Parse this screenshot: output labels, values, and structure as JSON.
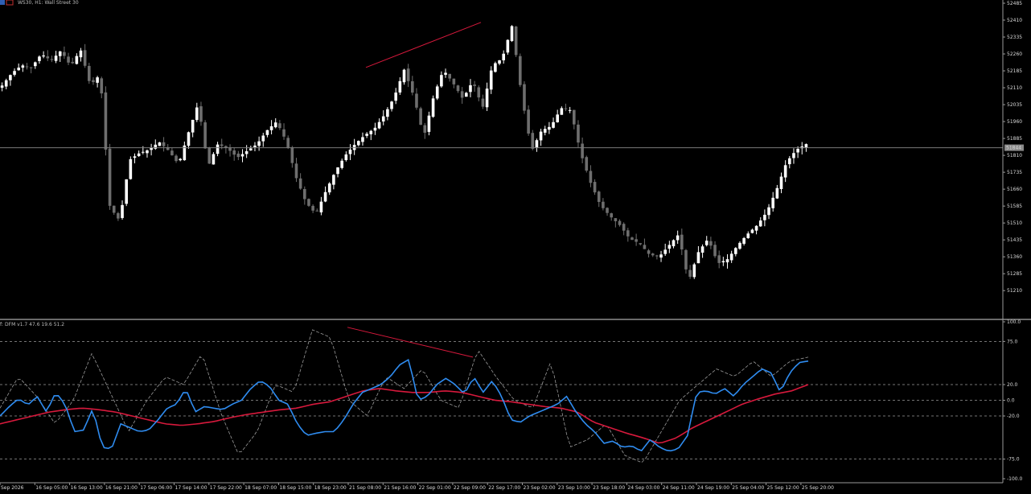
{
  "header": {
    "symbol_label": "WS30, H1: Wall Street 30",
    "indicator_label": "DFM v1.7 47.6 19.6 51.2"
  },
  "colors": {
    "background": "#000000",
    "bull_candle": "#ffffff",
    "bear_candle": "#6e6e6e",
    "osc_fast": "#2f8cf0",
    "osc_slow": "#d7193c",
    "osc_raw": "#9a9a9a",
    "divergence": "#d7193c",
    "current_price_line": "#7a7a7a",
    "grid_levels": "#9a9a9a"
  },
  "chart_data": [
    {
      "type": "candlestick",
      "title": "WS30, H1: Wall Street 30",
      "ylim": [
        51150,
        52485
      ],
      "yticks": [
        52485,
        52410,
        52335,
        52260,
        52185,
        52110,
        52035,
        51960,
        51885,
        51810,
        51735,
        51660,
        51585,
        51510,
        51435,
        51360,
        51285,
        51210
      ],
      "current_price": 51844,
      "current_price_label": "51844",
      "candle_count": 195,
      "x_labels": [
        "Sep 2026",
        "16 Sep 05:00",
        "16 Sep 13:00",
        "16 Sep 21:00",
        "17 Sep 06:00",
        "17 Sep 14:00",
        "17 Sep 22:00",
        "18 Sep 07:00",
        "18 Sep 15:00",
        "18 Sep 23:00",
        "21 Sep 08:00",
        "21 Sep 16:00",
        "22 Sep 01:00",
        "22 Sep 09:00",
        "22 Sep 17:00",
        "23 Sep 02:00",
        "23 Sep 10:00",
        "23 Sep 18:00",
        "24 Sep 03:00",
        "24 Sep 11:00",
        "24 Sep 19:00",
        "25 Sep 04:00",
        "25 Sep 12:00",
        "25 Sep 20:00"
      ],
      "close_path": [
        52120,
        52175,
        52210,
        52200,
        52260,
        52230,
        52275,
        52205,
        52280,
        52120,
        52170,
        51580,
        51520,
        51790,
        51820,
        51835,
        51870,
        51830,
        51770,
        51910,
        52040,
        51760,
        51860,
        51840,
        51800,
        51830,
        51860,
        51920,
        51960,
        51870,
        51710,
        51600,
        51550,
        51650,
        51740,
        51810,
        51860,
        51900,
        51930,
        51990,
        52070,
        52190,
        52070,
        51890,
        52070,
        52190,
        52130,
        52060,
        52140,
        52020,
        52210,
        52240,
        52385,
        52070,
        51830,
        51920,
        51940,
        52020,
        52010,
        51820,
        51690,
        51590,
        51540,
        51500,
        51440,
        51420,
        51370,
        51360,
        51410,
        51460,
        51250,
        51380,
        51440,
        51330,
        51350,
        51410,
        51460,
        51500,
        51560,
        51660,
        51780,
        51835,
        51860
      ],
      "divergence_line": {
        "from_value": 52200,
        "to_value": 52400
      }
    },
    {
      "type": "line",
      "title": "DFM v1.7 47.6 19.6 51.2",
      "ylim": [
        -100,
        100
      ],
      "yticks": [
        100.0,
        75.0,
        20.0,
        0.0,
        -20.0,
        -75.0,
        -100.0
      ],
      "ytick_labels": [
        "100.0",
        "75.0",
        "20.0",
        "0.0",
        "-20.0",
        "-75.0",
        "-100.0"
      ],
      "dashed_levels": [
        75,
        20,
        0,
        -20,
        -75
      ],
      "series": [
        {
          "values_path": [
            -20,
            -8,
            2,
            -6,
            5,
            -15,
            10,
            -5,
            -40,
            -38,
            -10,
            -60,
            -62,
            -30,
            -35,
            -40,
            -38,
            -25,
            -10,
            -5,
            15,
            -15,
            -8,
            -10,
            -12,
            -5,
            0,
            15,
            25,
            18,
            0,
            -5,
            -30,
            -45,
            -42,
            -40,
            -40,
            -25,
            -5,
            10,
            15,
            20,
            30,
            45,
            52,
            0,
            5,
            20,
            28,
            20,
            8,
            30,
            10,
            25,
            5,
            -25,
            -28,
            -20,
            -15,
            -10,
            -5,
            5,
            -15,
            -30,
            -40,
            -55,
            -52,
            -60,
            -58,
            -65,
            -50,
            -60,
            -65,
            -62,
            -45,
            10,
            12,
            8,
            15,
            5,
            20,
            30,
            40,
            35,
            10,
            35,
            48,
            50
          ]
        },
        {
          "values_path": [
            -30,
            -25,
            -20,
            -15,
            -12,
            -10,
            -12,
            -15,
            -20,
            -25,
            -30,
            -32,
            -30,
            -27,
            -22,
            -18,
            -15,
            -12,
            -10,
            -5,
            -2,
            5,
            12,
            15,
            12,
            10,
            10,
            12,
            10,
            5,
            0,
            -2,
            -5,
            -8,
            -10,
            -15,
            -28,
            -35,
            -42,
            -48,
            -55,
            -48,
            -35,
            -25,
            -15,
            -5,
            2,
            8,
            12,
            20
          ]
        },
        {
          "values_path": [
            -10,
            30,
            5,
            -30,
            0,
            60,
            10,
            -40,
            0,
            30,
            20,
            60,
            -15,
            -70,
            -40,
            20,
            10,
            90,
            80,
            0,
            -20,
            30,
            15,
            40,
            0,
            -10,
            65,
            30,
            0,
            -10,
            50,
            -60,
            -50,
            -30,
            -70,
            -80,
            -40,
            0,
            20,
            40,
            30,
            50,
            30,
            50,
            55
          ]
        }
      ],
      "divergence_line": {
        "from_value": 93,
        "to_value": 55
      }
    }
  ]
}
